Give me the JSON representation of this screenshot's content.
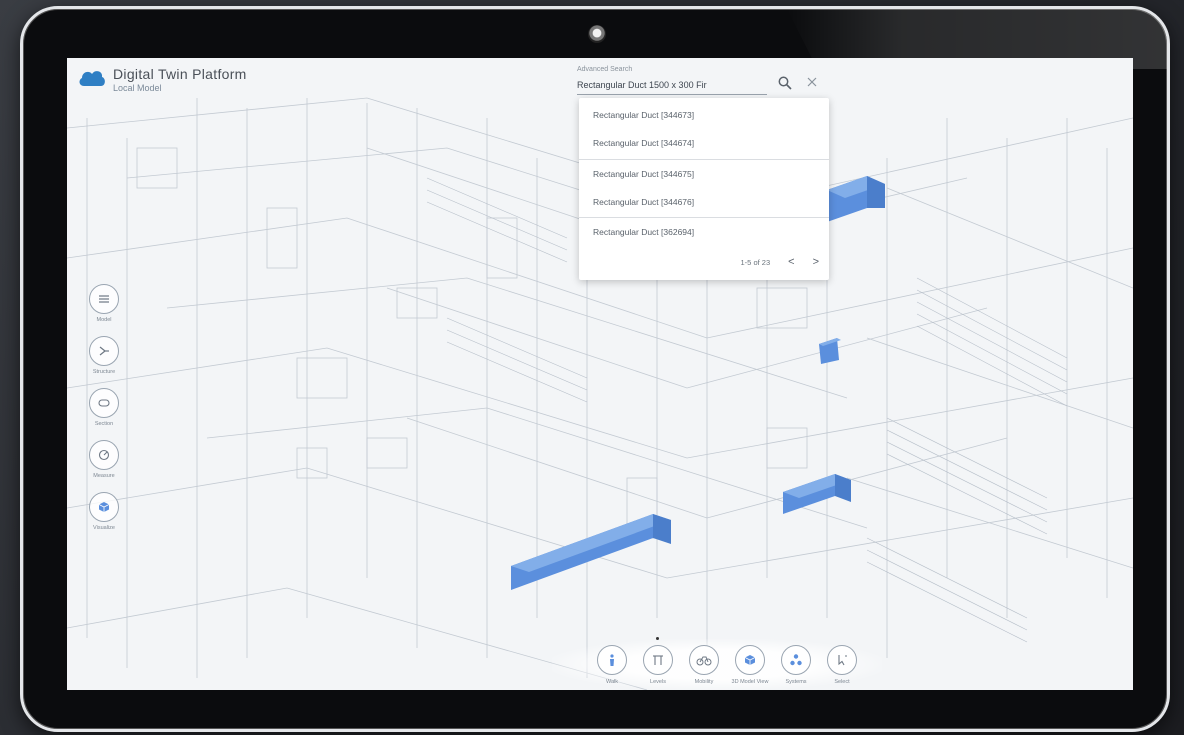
{
  "app": {
    "title": "Digital Twin Platform",
    "subtitle": "Local Model"
  },
  "search": {
    "label": "Advanced Search",
    "value": "Rectangular Duct 1500 x 300 Fir",
    "search_icon": "search-icon",
    "close_icon": "close-icon"
  },
  "results": {
    "items": [
      {
        "label": "Rectangular Duct [344673]"
      },
      {
        "label": "Rectangular Duct [344674]"
      },
      {
        "label": "Rectangular Duct [344675]"
      },
      {
        "label": "Rectangular Duct [344676]"
      },
      {
        "label": "Rectangular Duct [362694]"
      }
    ],
    "pagination": "1-5 of 23",
    "prev": "<",
    "next": ">"
  },
  "side_tools": [
    {
      "icon": "list-icon",
      "label": "Model"
    },
    {
      "icon": "tree-icon",
      "label": "Structure"
    },
    {
      "icon": "section-icon",
      "label": "Section"
    },
    {
      "icon": "measure-icon",
      "label": "Measure"
    },
    {
      "icon": "cube-icon",
      "label": "Visualize"
    }
  ],
  "bottom_tools": [
    {
      "icon": "person-icon",
      "label": "Walk"
    },
    {
      "icon": "levels-icon",
      "label": "Levels"
    },
    {
      "icon": "bike-icon",
      "label": "Mobility"
    },
    {
      "icon": "cube-filled-icon",
      "label": "3D Model View"
    },
    {
      "icon": "network-icon",
      "label": "Systems"
    },
    {
      "icon": "pointer-icon",
      "label": "Select"
    }
  ],
  "colors": {
    "accent_blue": "#5b8fdd",
    "logo_blue": "#2f7fc4",
    "line_gray": "#9aa5b1"
  }
}
